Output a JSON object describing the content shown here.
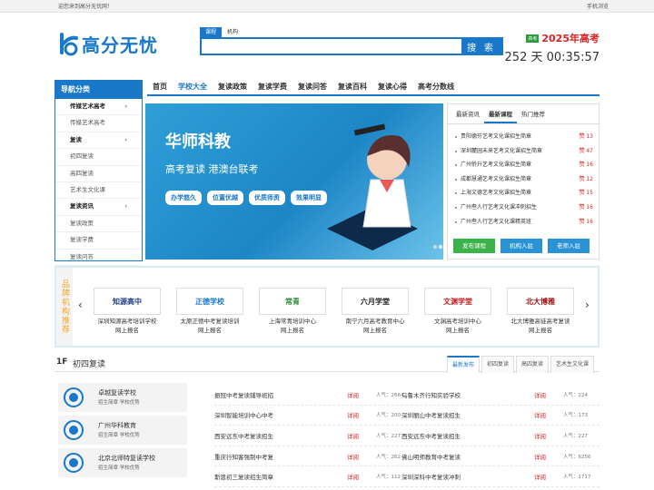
{
  "topbar": {
    "welcome": "迎您来到高分无忧网！",
    "mobile": "手机浏览"
  },
  "logo": {
    "text": "高分无忧"
  },
  "search": {
    "tabs": [
      "课程",
      "机构"
    ],
    "button": "搜 索",
    "placeholder": ""
  },
  "countdown": {
    "badge": "高考",
    "title": "2025年高考",
    "timer": "252 天 00:35:57"
  },
  "nav": {
    "items": [
      "首页",
      "学校大全",
      "复读政策",
      "复读学费",
      "复读问答",
      "复读百科",
      "复读心得",
      "高考分数线"
    ]
  },
  "sidebar": {
    "title": "导航分类",
    "items": [
      {
        "label": "传媒艺术高考",
        "bold": true,
        "arrow": "›"
      },
      {
        "label": "传媒艺术高考",
        "bold": false,
        "arrow": ""
      },
      {
        "label": "复读",
        "bold": true,
        "arrow": "›"
      },
      {
        "label": "初四复读",
        "bold": false,
        "arrow": ""
      },
      {
        "label": "高四复读",
        "bold": false,
        "arrow": ""
      },
      {
        "label": "艺术生文化课",
        "bold": false,
        "arrow": ""
      },
      {
        "label": "复读资讯",
        "bold": true,
        "arrow": "›"
      },
      {
        "label": "复读政策",
        "bold": false,
        "arrow": ""
      },
      {
        "label": "复读学费",
        "bold": false,
        "arrow": ""
      },
      {
        "label": "复读问答",
        "bold": false,
        "arrow": ""
      }
    ]
  },
  "banner": {
    "title": "华师科教",
    "subtitle": "高考复读  港澳台联考",
    "tags": [
      "办学悠久",
      "位置优越",
      "优质师资",
      "效果明显"
    ]
  },
  "news": {
    "tabs": [
      "最新资讯",
      "最新课程",
      "热门推荐"
    ],
    "items": [
      {
        "title": "贵阳德芬艺考文化课招生简章",
        "count": "赞 13"
      },
      {
        "title": "深圳麓园未来艺考文化课招生简章",
        "count": "赞 47"
      },
      {
        "title": "广州侨升艺考文化课招生简章",
        "count": "赞 16"
      },
      {
        "title": "成都慧通艺考文化课招生简章",
        "count": "赞 12"
      },
      {
        "title": "上海文德艺考文化课招生简章",
        "count": "赞 15"
      },
      {
        "title": "广州叁人行艺考文化课冲刺招生",
        "count": "赞 16"
      },
      {
        "title": "广州叁人行艺考文化课精英班",
        "count": "赞 16"
      }
    ],
    "buttons": [
      {
        "label": "发布课程",
        "color": "#3bb34a"
      },
      {
        "label": "机构入驻",
        "color": "#2a93d5"
      },
      {
        "label": "老师入驻",
        "color": "#2a93d5"
      }
    ]
  },
  "brands": {
    "label": "品牌机构推荐",
    "items": [
      {
        "logo": "知源高中",
        "line1": "深圳知源高考培训学校",
        "line2": "网上报名",
        "color": "#1f3c88"
      },
      {
        "logo": "正德学校",
        "line1": "太原正德中考复读培训",
        "line2": "网上报名",
        "color": "#1a78c8"
      },
      {
        "logo": "常青",
        "line1": "上海常青培训中心",
        "line2": "网上报名",
        "color": "#2a8a3a"
      },
      {
        "logo": "六月学堂",
        "line1": "南宁六月高考教育中心",
        "line2": "网上报名",
        "color": "#222"
      },
      {
        "logo": "文渊学堂",
        "line1": "文渊高考培训中心",
        "line2": "网上报名",
        "color": "#c21f1f"
      },
      {
        "logo": "北大博雅",
        "line1": "北大博雅高徒高考复读",
        "line2": "网上报名",
        "color": "#a01010"
      }
    ]
  },
  "floor": {
    "number": "1F",
    "title": "初四复读",
    "tabs": [
      "最新发布",
      "初四复读",
      "高四复读",
      "艺术生文化课"
    ]
  },
  "schools": [
    {
      "name": "卓越复读学校",
      "links": "招生简章  学校优势"
    },
    {
      "name": "广州华科教育",
      "links": "招生简章  学校优势"
    },
    {
      "name": "北京北师特复读学校",
      "links": "招生简章  学校优势"
    }
  ],
  "list_left": [
    {
      "title": "振冠中考复读辅导班招",
      "detail": "详阅",
      "views": "人气：2664"
    },
    {
      "title": "深圳智能培训中心中考",
      "detail": "详阅",
      "views": "人气：200"
    },
    {
      "title": "西安远东中考复读招生",
      "detail": "详阅",
      "views": "人气：227"
    },
    {
      "title": "重庆行知客强制中考复",
      "detail": "详阅",
      "views": "人气：262"
    },
    {
      "title": "斯恩初三复读招生简章",
      "detail": "详阅",
      "views": "人气：112"
    }
  ],
  "list_right": [
    {
      "title": "乌鲁木齐行知实验学校",
      "detail": "详阅",
      "views": "人气：224"
    },
    {
      "title": "深圳丽山中考复读招生",
      "detail": "详阅",
      "views": "人气：173"
    },
    {
      "title": "西安远东中考复读招生",
      "detail": "详阅",
      "views": "人气：227"
    },
    {
      "title": "佛山明师教育中考复读",
      "detail": "详阅",
      "views": "人气：6256"
    },
    {
      "title": "深圳深科中考复读冲刺",
      "detail": "详阅",
      "views": "人气：1717"
    }
  ]
}
